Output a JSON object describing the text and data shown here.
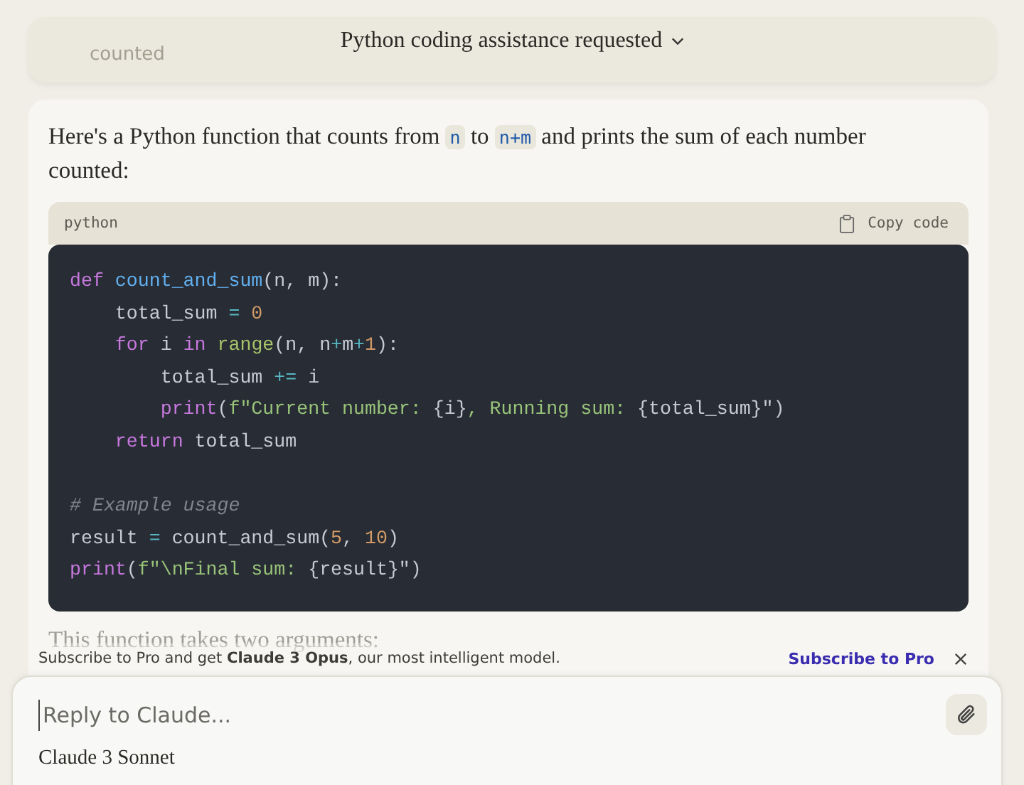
{
  "header": {
    "title": "Python coding assistance requested",
    "faded_text": "counted"
  },
  "message": {
    "intro": [
      {
        "kind": "text",
        "text": "Here's a Python function that counts from "
      },
      {
        "kind": "code",
        "text": "n"
      },
      {
        "kind": "text",
        "text": " to "
      },
      {
        "kind": "code",
        "text": "n+m"
      },
      {
        "kind": "text",
        "text": " and prints the sum of each number counted:"
      }
    ],
    "code_block": {
      "language": "python",
      "copy_label": "Copy code",
      "lines": [
        {
          "tokens": [
            {
              "kind": "kw",
              "text": "def"
            },
            {
              "kind": "fn",
              "text": " count_and_sum"
            },
            {
              "kind": "plain",
              "text": "(n, m):"
            }
          ]
        },
        {
          "tokens": [
            {
              "kind": "plain",
              "text": "    total_sum "
            },
            {
              "kind": "op",
              "text": "="
            },
            {
              "kind": "num",
              "text": " 0"
            }
          ]
        },
        {
          "tokens": [
            {
              "kind": "kw",
              "text": "    for"
            },
            {
              "kind": "plain",
              "text": " i "
            },
            {
              "kind": "kw",
              "text": "in"
            },
            {
              "kind": "builtin",
              "text": " range"
            },
            {
              "kind": "plain",
              "text": "(n, n"
            },
            {
              "kind": "op",
              "text": "+"
            },
            {
              "kind": "plain",
              "text": "m"
            },
            {
              "kind": "op",
              "text": "+"
            },
            {
              "kind": "num",
              "text": "1"
            },
            {
              "kind": "plain",
              "text": "):"
            }
          ]
        },
        {
          "tokens": [
            {
              "kind": "plain",
              "text": "        total_sum "
            },
            {
              "kind": "op",
              "text": "+="
            },
            {
              "kind": "plain",
              "text": " i"
            }
          ]
        },
        {
          "tokens": [
            {
              "kind": "kw",
              "text": "        print"
            },
            {
              "kind": "plain",
              "text": "("
            },
            {
              "kind": "str",
              "text": "f\"Current number: "
            },
            {
              "kind": "plain",
              "text": "{i}"
            },
            {
              "kind": "str",
              "text": ", Running sum: "
            },
            {
              "kind": "plain",
              "text": "{total_sum}\")"
            }
          ]
        },
        {
          "tokens": [
            {
              "kind": "kw",
              "text": "    return"
            },
            {
              "kind": "plain",
              "text": " total_sum"
            }
          ]
        },
        {
          "blank_before": true,
          "tokens": [
            {
              "kind": "comment",
              "text": "# Example usage"
            }
          ]
        },
        {
          "tokens": [
            {
              "kind": "plain",
              "text": "result "
            },
            {
              "kind": "op",
              "text": "="
            },
            {
              "kind": "plain",
              "text": " count_and_sum("
            },
            {
              "kind": "num",
              "text": "5"
            },
            {
              "kind": "plain",
              "text": ", "
            },
            {
              "kind": "num",
              "text": "10"
            },
            {
              "kind": "plain",
              "text": ")"
            }
          ]
        },
        {
          "tokens": [
            {
              "kind": "kw",
              "text": "print"
            },
            {
              "kind": "plain",
              "text": "("
            },
            {
              "kind": "str",
              "text": "f\"\\nFinal sum: "
            },
            {
              "kind": "plain",
              "text": "{result}\")"
            }
          ]
        }
      ]
    },
    "outro": "This function takes two arguments:"
  },
  "banner": {
    "text": "Subscribe to Pro and get **Claude 3 Opus**, our most intelligent model.",
    "link": "Subscribe to Pro"
  },
  "composer": {
    "placeholder": "Reply to Claude...",
    "model": "Claude 3 Sonnet"
  }
}
